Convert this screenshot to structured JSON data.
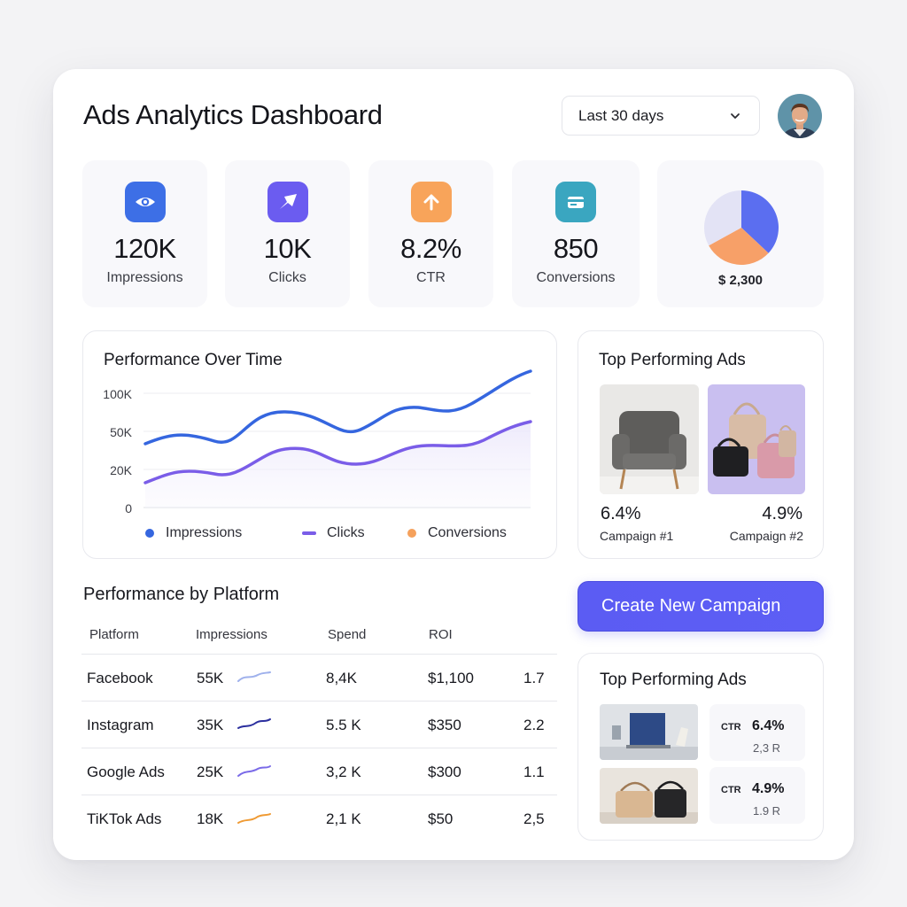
{
  "header": {
    "title": "Ads Analytics Dashboard",
    "date_range": "Last 30 days"
  },
  "kpis": [
    {
      "value": "120K",
      "label": "Impressions",
      "icon": "eye-icon",
      "color": "#3d6fe6"
    },
    {
      "value": "10K",
      "label": "Clicks",
      "icon": "cursor-click-icon",
      "color": "#6b5cf0"
    },
    {
      "value": "8.2%",
      "label": "CTR",
      "icon": "arrow-up-icon",
      "color": "#f8a45a"
    },
    {
      "value": "850",
      "label": "Conversions",
      "icon": "wallet-icon",
      "color": "#3aa6c0"
    }
  ],
  "spend_pie": {
    "amount": "$ 2,300",
    "slices": [
      {
        "value": 0.37,
        "color": "#5b6ef0"
      },
      {
        "value": 0.3,
        "color": "#f7a068"
      },
      {
        "value": 0.33,
        "color": "#e3e3f5"
      }
    ]
  },
  "performance_chart": {
    "title": "Performance Over Time",
    "y_ticks": [
      "100K",
      "50K",
      "20K",
      "0"
    ],
    "legend": [
      "Impressions",
      "Clicks",
      "Conversions"
    ],
    "colors": {
      "impressions": "#3566df",
      "clicks": "#7a5de8",
      "conversions": "#f5a15c"
    }
  },
  "top_ads": {
    "title": "Top Performing Ads",
    "items": [
      {
        "pct": "6.4%",
        "campaign": "Campaign #1",
        "image": "armchair-image"
      },
      {
        "pct": "4.9%",
        "campaign": "Campaign #2",
        "image": "handbags-image"
      }
    ]
  },
  "platform_table": {
    "title": "Performance by Platform",
    "headers": {
      "platform": "Platform",
      "impressions": "Impressions",
      "spend": "Spend",
      "roi": "ROI"
    },
    "rows": [
      {
        "platform": "Facebook",
        "impressions": "55K",
        "spend": "8,4K",
        "roi": "$1,100",
        "ratio": "1.7",
        "spark_color": "#9fb1ec"
      },
      {
        "platform": "Instagram",
        "impressions": "35K",
        "spend": "5.5 K",
        "roi": "$350",
        "ratio": "2.2",
        "spark_color": "#2b2f9e"
      },
      {
        "platform": "Google Ads",
        "impressions": "25K",
        "spend": "3,2 K",
        "roi": "$300",
        "ratio": "1.1",
        "spark_color": "#7a6ae8"
      },
      {
        "platform": "TiKTok Ads",
        "impressions": "18K",
        "spend": "2,1 K",
        "roi": "$50",
        "ratio": "2,5",
        "spark_color": "#ef9a33"
      }
    ]
  },
  "cta": {
    "label": "Create New Campaign"
  },
  "top_ads_2": {
    "title": "Top Performing Ads",
    "items": [
      {
        "ctr_label": "CTR",
        "ctr": "6.4%",
        "sub": "2,3 R"
      },
      {
        "ctr_label": "CTR",
        "ctr": "4.9%",
        "sub": "1.9 R"
      }
    ]
  }
}
